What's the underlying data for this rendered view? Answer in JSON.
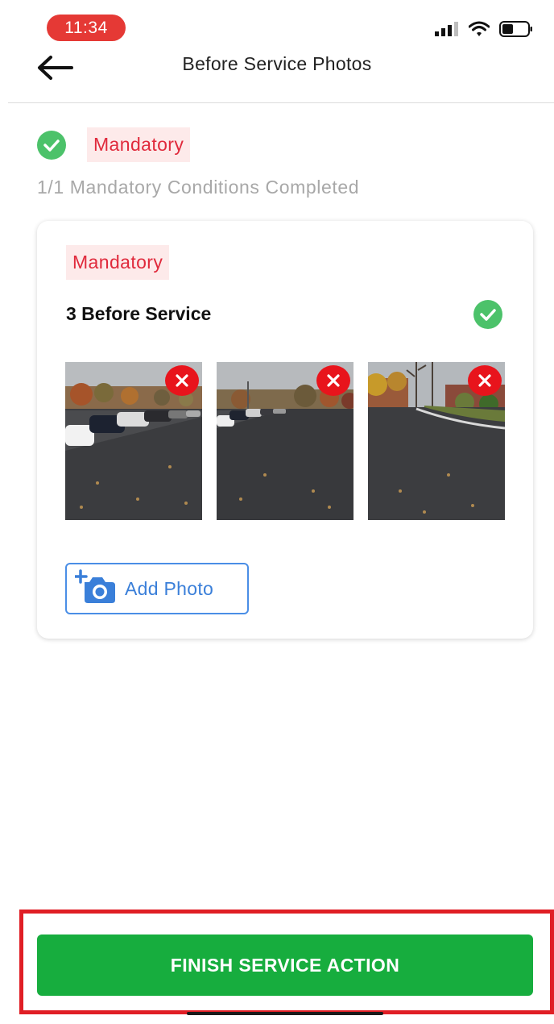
{
  "status_bar": {
    "time": "11:34",
    "icons": [
      "cellular-signal-icon",
      "wifi-icon",
      "battery-icon"
    ]
  },
  "header": {
    "title": "Before Service Photos",
    "back_icon": "arrow-left-icon"
  },
  "summary": {
    "tag": "Mandatory",
    "progress_text": "1/1 Mandatory Conditions Completed"
  },
  "condition_card": {
    "tag": "Mandatory",
    "title": "3 Before Service",
    "photos": [
      {
        "scene": "parking-lot-with-cars"
      },
      {
        "scene": "empty-parking-lot"
      },
      {
        "scene": "parking-lot-with-trees"
      }
    ],
    "add_photo_label": "Add Photo"
  },
  "footer": {
    "finish_label": "FINISH SERVICE ACTION"
  },
  "colors": {
    "accent_green": "#17ad3e",
    "check_green": "#4cc26a",
    "mandatory_red": "#e02a3c",
    "mandatory_bg": "#fdeaea",
    "link_blue": "#3a7fd9",
    "highlight_red": "#e01e25"
  }
}
